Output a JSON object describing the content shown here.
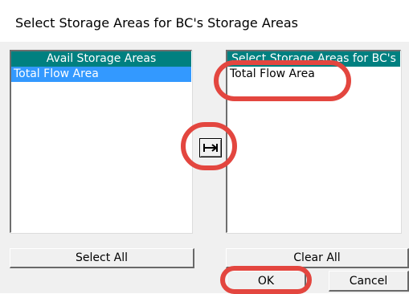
{
  "window": {
    "title": "Select Storage Areas for BC's Storage Areas"
  },
  "available_list": {
    "header": "Avail Storage Areas",
    "items": [
      "Total Flow Area"
    ],
    "selected_index": 0
  },
  "selected_list": {
    "header": "Select Storage Areas for BC's",
    "items": [
      "Total Flow Area"
    ]
  },
  "buttons": {
    "select_all": "Select All",
    "clear_all": "Clear All",
    "ok": "OK",
    "cancel": "Cancel",
    "move_right_icon": "arrow-right-icon"
  },
  "colors": {
    "list_header_bg": "#008080",
    "selection_bg": "#3399ff",
    "annotation_circle": "#e3463f"
  }
}
